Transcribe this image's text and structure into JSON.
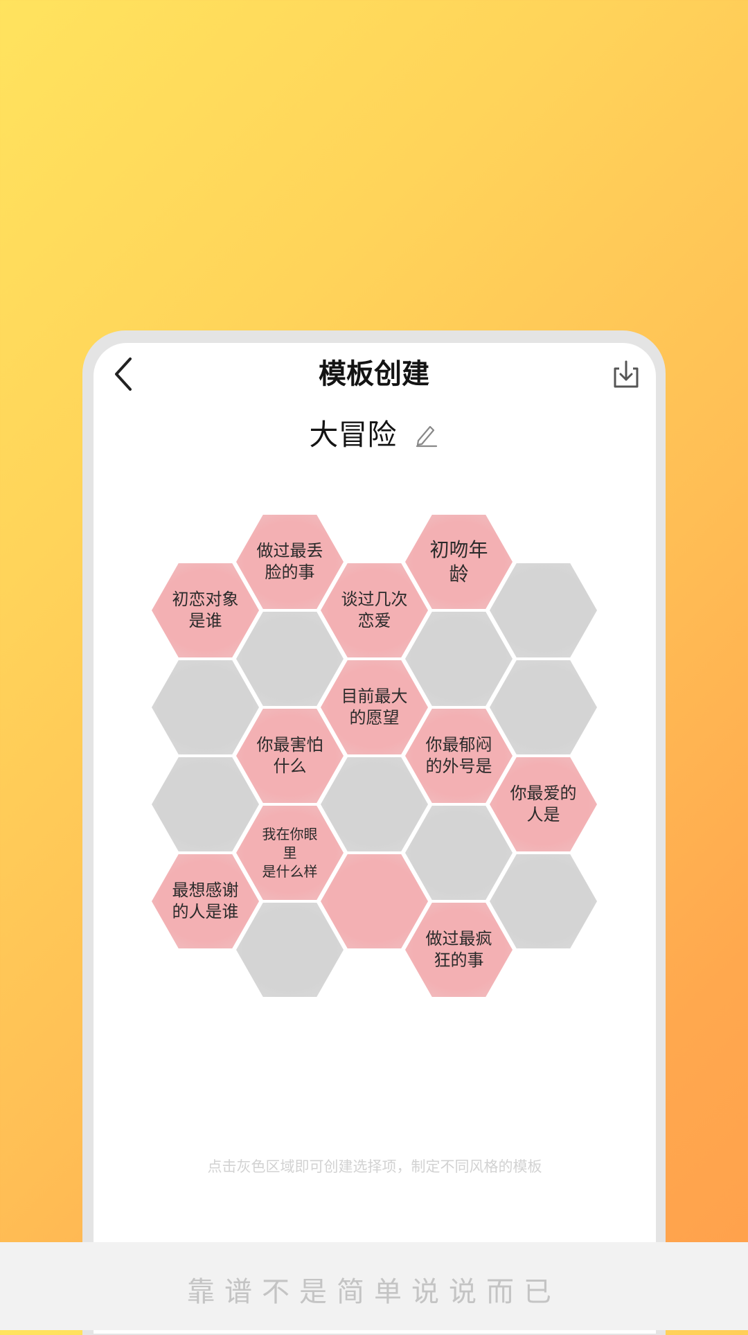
{
  "header": {
    "title": "模板创建"
  },
  "template": {
    "name": "大冒险"
  },
  "hexes": [
    "做过最丢\n脸的事",
    "初吻年\n龄",
    "初恋对象\n是谁",
    "谈过几次\n恋爱",
    "",
    "",
    "",
    "",
    "目前最大\n的愿望",
    "",
    "你最害怕\n什么",
    "你最郁闷\n的外号是",
    "",
    "",
    "你最爱的\n人是",
    "我在你眼里\n是什么样",
    "",
    "最想感谢\n的人是谁",
    "",
    "",
    "做过最疯\n狂的事"
  ],
  "hint": "点击灰色区域即可创建选择项，制定不同风格的模板",
  "slogan": "靠谱不是简单说说而已"
}
